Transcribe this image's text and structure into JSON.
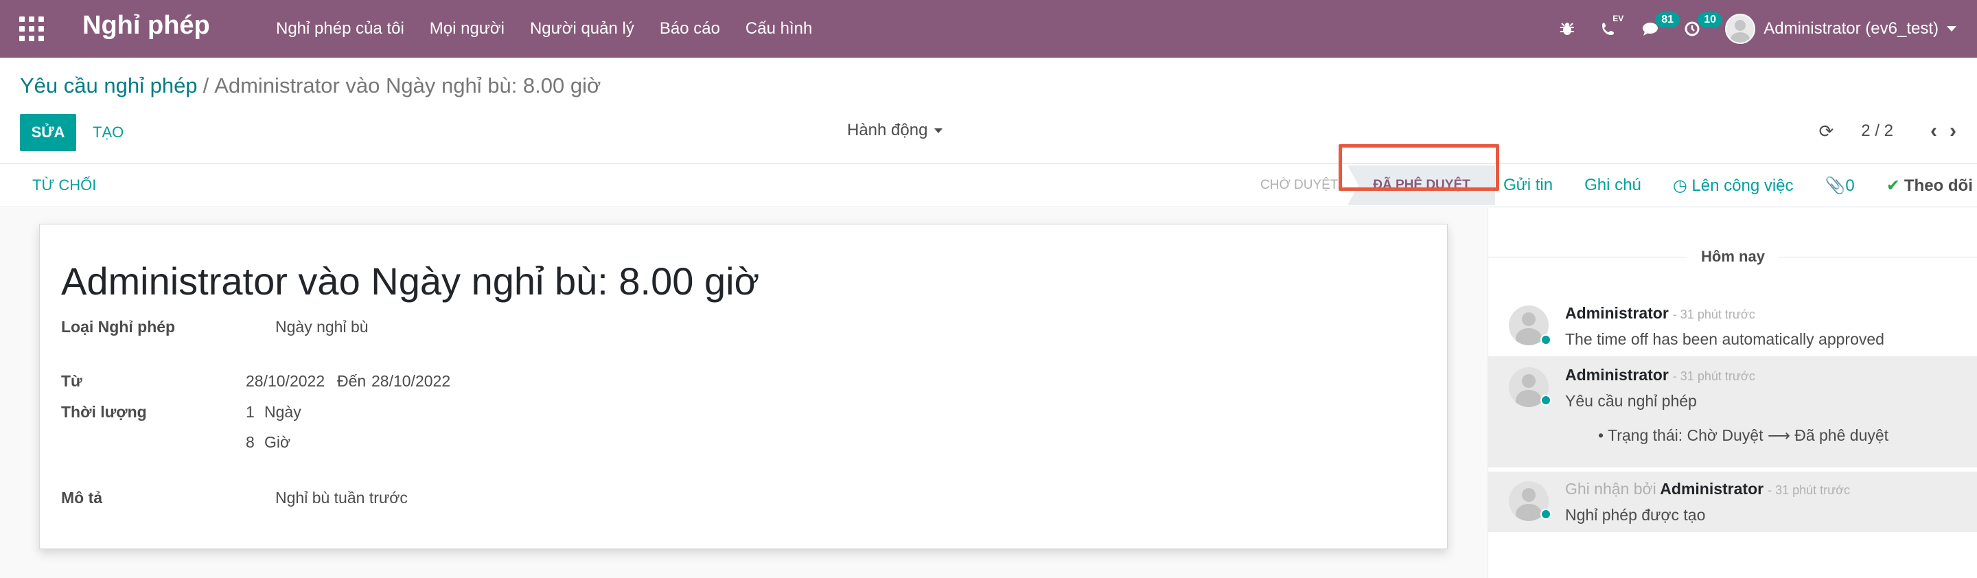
{
  "navbar": {
    "app_title": "Nghỉ phép",
    "menu": [
      "Nghỉ phép của tôi",
      "Mọi người",
      "Người quản lý",
      "Báo cáo",
      "Cấu hình"
    ],
    "ev_tag": "EV",
    "messages_count": "81",
    "activities_count": "10",
    "user": "Administrator (ev6_test)"
  },
  "breadcrumb": {
    "parent": "Yêu cầu nghỉ phép",
    "separator": "/",
    "current": "Administrator vào Ngày nghỉ bù: 8.00 giờ"
  },
  "toolbar": {
    "edit": "SỬA",
    "create": "TẠO",
    "action": "Hành động",
    "pager": "2 / 2"
  },
  "statusbar": {
    "refuse": "TỪ CHỐI",
    "stage_waiting": "CHỜ DUYỆT",
    "stage_approved": "ĐÃ PHÊ DUYỆT"
  },
  "chatter_actions": {
    "send_message": "Gửi tin",
    "log_note": "Ghi chú",
    "schedule_activity": "Lên công việc",
    "attachments": "0",
    "follow": "Theo dõi"
  },
  "form": {
    "title": "Administrator vào Ngày nghỉ bù: 8.00 giờ",
    "leave_type_label": "Loại Nghỉ phép",
    "leave_type_value": "Ngày nghỉ bù",
    "from_label": "Từ",
    "date_from": "28/10/2022",
    "to_word": "Đến",
    "date_to": "28/10/2022",
    "duration_label": "Thời lượng",
    "duration_days": "1",
    "days_unit": "Ngày",
    "duration_hours": "8",
    "hours_unit": "Giờ",
    "description_label": "Mô tả",
    "description_value": "Nghỉ bù tuần trước"
  },
  "chatter": {
    "day": "Hôm nay",
    "messages": [
      {
        "author": "Administrator",
        "time": "- 31 phút trước",
        "body": "The time off has been automatically approved"
      },
      {
        "author": "Administrator",
        "time": "- 31 phút trước",
        "body": "Yêu cầu nghỉ phép",
        "tracking": "Trạng thái: Chờ Duyệt ⟶ Đã phê duyệt"
      },
      {
        "prefix": "Ghi nhận bởi",
        "author": "Administrator",
        "time": "- 31 phút trước",
        "body": "Nghỉ phép được tạo"
      }
    ]
  }
}
